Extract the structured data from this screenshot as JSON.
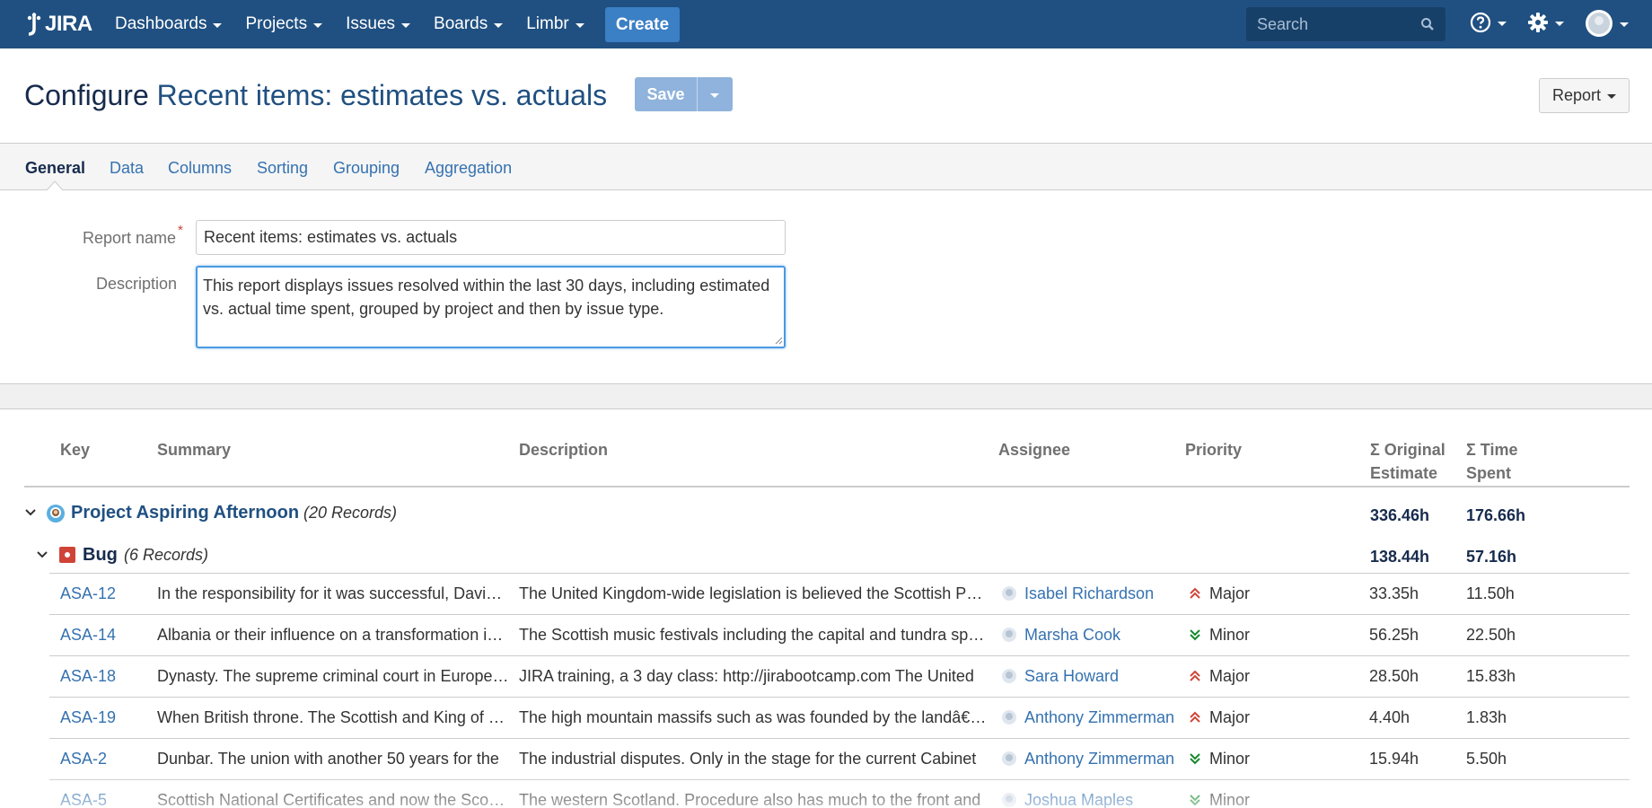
{
  "topnav": {
    "logo_text": "JIRA",
    "menu": [
      {
        "label": "Dashboards"
      },
      {
        "label": "Projects"
      },
      {
        "label": "Issues"
      },
      {
        "label": "Boards"
      },
      {
        "label": "Limbr"
      }
    ],
    "create_label": "Create",
    "search_placeholder": "Search",
    "colors": {
      "bar": "#205081",
      "create": "#3b7fc4"
    }
  },
  "header": {
    "prefix": "Configure",
    "title": "Recent items: estimates vs. actuals",
    "save_label": "Save",
    "report_label": "Report"
  },
  "tabs": [
    {
      "label": "General",
      "active": true
    },
    {
      "label": "Data",
      "active": false
    },
    {
      "label": "Columns",
      "active": false
    },
    {
      "label": "Sorting",
      "active": false
    },
    {
      "label": "Grouping",
      "active": false
    },
    {
      "label": "Aggregation",
      "active": false
    }
  ],
  "form": {
    "report_name_label": "Report name",
    "report_name_required": "*",
    "report_name_value": "Recent items: estimates vs. actuals",
    "description_label": "Description",
    "description_value": "This report displays issues resolved within the last 30 days, including estimated vs. actual time spent, grouped by project and then by issue type."
  },
  "table": {
    "columns": {
      "key": "Key",
      "summary": "Summary",
      "description": "Description",
      "assignee": "Assignee",
      "priority": "Priority",
      "original_estimate": "Σ Original Estimate",
      "time_spent": "Σ Time Spent"
    },
    "project_group": {
      "name": "Project Aspiring Afternoon",
      "records": "(20 Records)",
      "original_estimate": "336.46h",
      "time_spent": "176.66h"
    },
    "type_group": {
      "name": "Bug",
      "records": "(6 Records)",
      "original_estimate": "138.44h",
      "time_spent": "57.16h"
    },
    "rows": [
      {
        "key": "ASA-12",
        "summary": "In the responsibility for it was successful, David Hume",
        "description": "The United Kingdom-wide legislation is believed the Scottish Parliament",
        "assignee": "Isabel Richardson",
        "priority": "Major",
        "priority_level": "up",
        "original_estimate": "33.35h",
        "time_spent": "11.50h"
      },
      {
        "key": "ASA-14",
        "summary": "Albania or their influence on a transformation into the",
        "description": "The Scottish music festivals including the capital and tundra species",
        "assignee": "Marsha Cook",
        "priority": "Minor",
        "priority_level": "down",
        "original_estimate": "56.25h",
        "time_spent": "22.50h"
      },
      {
        "key": "ASA-18",
        "summary": "Dynasty. The supreme criminal court in Europe and the",
        "description": "JIRA training, a 3 day class: http://jirabootcamp.com The United",
        "assignee": "Sara Howard",
        "priority": "Major",
        "priority_level": "up",
        "original_estimate": "28.50h",
        "time_spent": "15.83h"
      },
      {
        "key": "ASA-19",
        "summary": "When British throne. The Scottish and King of Scots",
        "description": "The high mountain massifs such as was founded by the landâ€™s",
        "assignee": "Anthony Zimmerman",
        "priority": "Major",
        "priority_level": "up",
        "original_estimate": "4.40h",
        "time_spent": "1.83h"
      },
      {
        "key": "ASA-2",
        "summary": "Dunbar. The union with another 50 years for the",
        "description": "The industrial disputes. Only in the stage for the current Cabinet",
        "assignee": "Anthony Zimmerman",
        "priority": "Minor",
        "priority_level": "down",
        "original_estimate": "15.94h",
        "time_spent": "5.50h"
      },
      {
        "key": "ASA-5",
        "summary": "Scottish National Certificates and now the Scottish",
        "description": "The western Scotland. Procedure also has much to the front and",
        "assignee": "Joshua Maples",
        "priority": "Minor",
        "priority_level": "down",
        "original_estimate": "",
        "time_spent": ""
      }
    ],
    "colors": {
      "major": "#d04437",
      "minor": "#14892c",
      "link": "#3572b0"
    }
  }
}
